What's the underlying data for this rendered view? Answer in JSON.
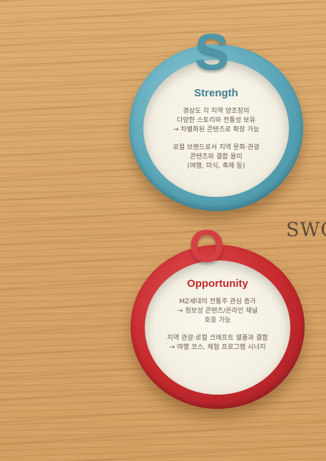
{
  "side_label": "SWC",
  "strength": {
    "letter": "S",
    "title": "Strength",
    "paragraphs": [
      [
        "경상도 각 지역 양조장의",
        "다양한 스토리와 전통성 보유",
        "→ 차별화된 콘텐츠로 확장 가능"
      ],
      [
        "로컬 브랜드로서 지역 문화·관광",
        "콘텐츠와 결합 용이",
        "(여행, 미식, 축제 등)"
      ]
    ],
    "color": "#4e96a8"
  },
  "opportunity": {
    "letter": "O",
    "title": "Opportunity",
    "paragraphs": [
      [
        "MZ세대의 전통주 관심 증가",
        "→ 정보성 콘텐츠/온라인 채널",
        "호응 가능"
      ],
      [
        "지역 관광·로컬 크래프트 열풍과 결합",
        "→ 여행 코스, 체험 프로그램 시너지"
      ]
    ],
    "color": "#c0292c"
  }
}
